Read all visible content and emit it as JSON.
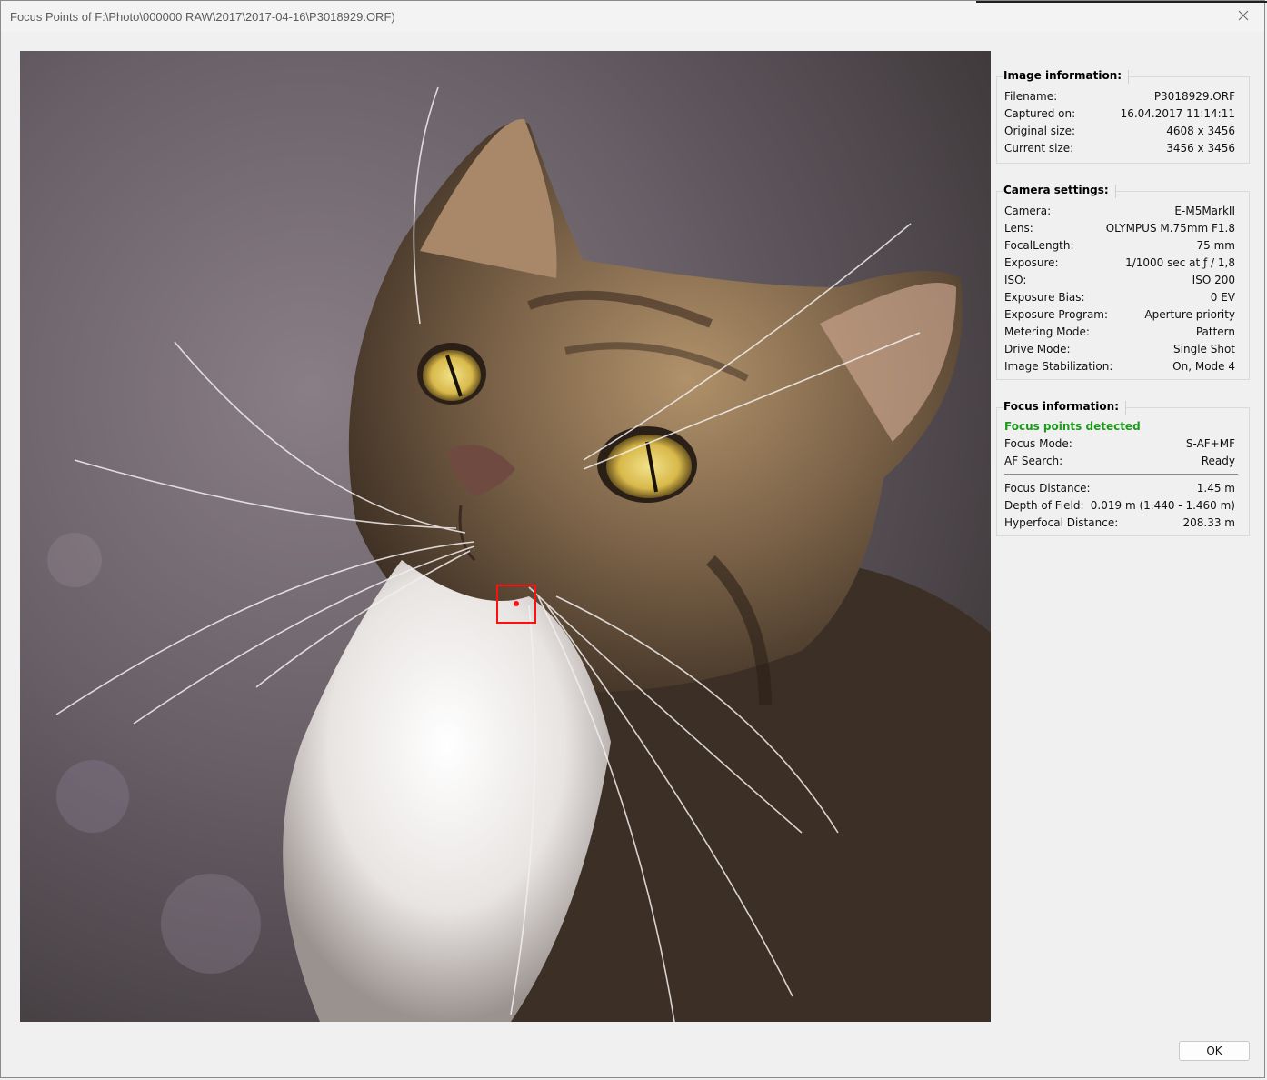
{
  "window": {
    "title": "Focus Points of F:\\Photo\\000000 RAW\\2017\\2017-04-16\\P3018929.ORF)",
    "close_icon": "close-icon"
  },
  "image_info": {
    "header": "Image information:",
    "rows": [
      {
        "label": "Filename:",
        "value": "P3018929.ORF"
      },
      {
        "label": "Captured on:",
        "value": "16.04.2017 11:14:11"
      },
      {
        "label": "Original size:",
        "value": "4608 x 3456"
      },
      {
        "label": "Current size:",
        "value": "3456 x 3456"
      }
    ]
  },
  "camera_settings": {
    "header": "Camera settings:",
    "rows": [
      {
        "label": "Camera:",
        "value": "E-M5MarkII"
      },
      {
        "label": "Lens:",
        "value": "OLYMPUS M.75mm F1.8"
      },
      {
        "label": "FocalLength:",
        "value": "75 mm"
      },
      {
        "label": "Exposure:",
        "value": "1/1000 sec at ƒ / 1,8"
      },
      {
        "label": "ISO:",
        "value": "ISO 200"
      },
      {
        "label": "Exposure Bias:",
        "value": "0 EV"
      },
      {
        "label": "Exposure Program:",
        "value": "Aperture priority"
      },
      {
        "label": "Metering Mode:",
        "value": "Pattern"
      },
      {
        "label": "Drive Mode:",
        "value": "Single Shot"
      },
      {
        "label": "Image Stabilization:",
        "value": "On, Mode 4"
      }
    ]
  },
  "focus_info": {
    "header": "Focus information:",
    "status": "Focus points detected",
    "status_color": "#1d9a1d",
    "rows_top": [
      {
        "label": "Focus Mode:",
        "value": "S-AF+MF"
      },
      {
        "label": "AF Search:",
        "value": "Ready"
      }
    ],
    "rows_bottom": [
      {
        "label": "Focus Distance:",
        "value": "1.45 m"
      },
      {
        "label": "Depth of Field:",
        "value": "0.019 m (1.440 - 1.460 m)"
      },
      {
        "label": "Hyperfocal Distance:",
        "value": "208.33 m"
      }
    ]
  },
  "focus_marker_color": "#ff1010",
  "buttons": {
    "ok": "OK"
  }
}
